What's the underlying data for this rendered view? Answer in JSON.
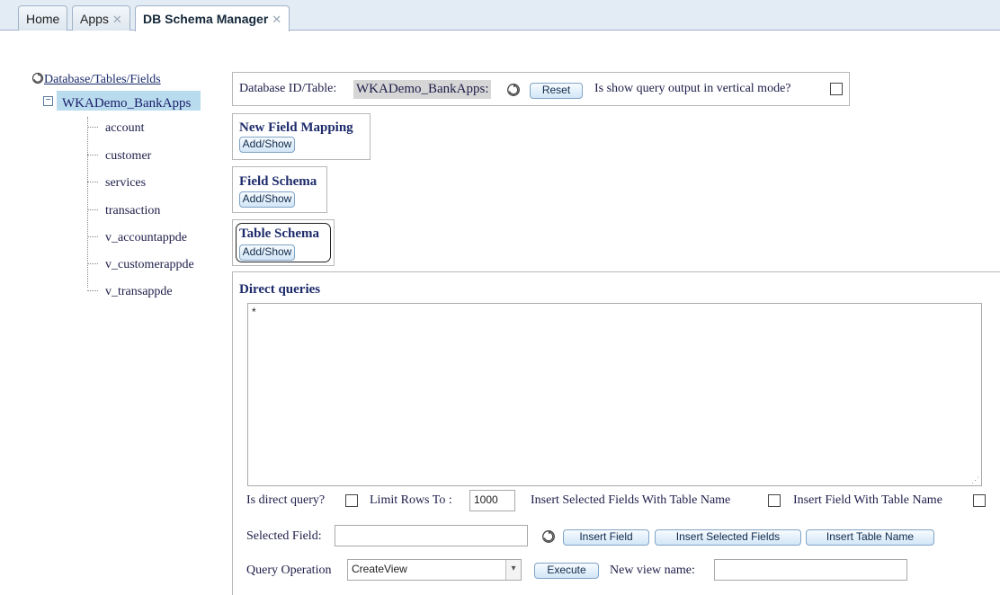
{
  "tabs": [
    {
      "label": "Home",
      "closable": false
    },
    {
      "label": "Apps",
      "closable": true
    },
    {
      "label": "DB Schema Manager",
      "closable": true,
      "active": true
    }
  ],
  "tree": {
    "root_label": "Database/Tables/Fields",
    "database": "WKADemo_BankApps",
    "tables": [
      "account",
      "customer",
      "services",
      "transaction",
      "v_accountappde",
      "v_customerappde",
      "v_transappde"
    ]
  },
  "header": {
    "db_label": "Database ID/Table:",
    "db_value": "WKADemo_BankApps:",
    "reset_label": "Reset",
    "vertical_label": "Is show query output in vertical mode?"
  },
  "sections": {
    "new_field_mapping": {
      "title": "New Field Mapping",
      "button": "Add/Show"
    },
    "field_schema": {
      "title": "Field Schema",
      "button": "Add/Show"
    },
    "table_schema": {
      "title": "Table Schema",
      "button": "Add/Show"
    }
  },
  "direct": {
    "title": "Direct queries",
    "query_text": "*",
    "is_direct_label": "Is direct query?",
    "limit_label": "Limit Rows To :",
    "limit_value": "1000",
    "insert_selected_with_table_label": "Insert Selected Fields With Table Name",
    "insert_field_with_table_label": "Insert Field With Table Name",
    "selected_field_label": "Selected Field:",
    "selected_field_value": "",
    "insert_field_btn": "Insert Field",
    "insert_selected_fields_btn": "Insert Selected Fields",
    "insert_table_name_btn": "Insert Table Name",
    "query_op_label": "Query Operation",
    "query_op_value": "CreateView",
    "execute_btn": "Execute",
    "new_view_label": "New view name:",
    "new_view_value": ""
  }
}
